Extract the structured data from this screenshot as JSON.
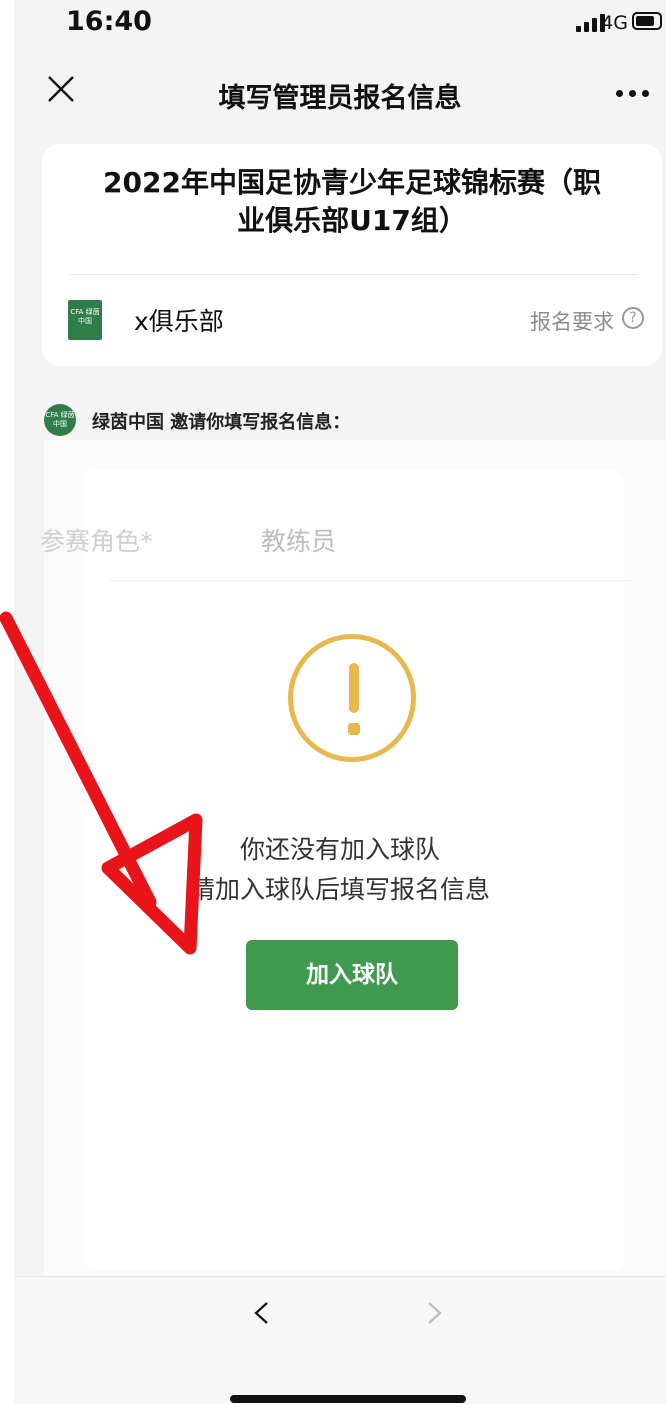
{
  "status_bar": {
    "time": "16:40",
    "network": "4G"
  },
  "navbar": {
    "title": "填写管理员报名信息"
  },
  "card": {
    "title_line1": "2022年中国足协青少年足球锦标赛（职",
    "title_line2": "业俱乐部U17组）",
    "club_name": "x俱乐部",
    "requirements_label": "报名要求",
    "club_logo_text": "CFA 绿茵中国"
  },
  "invite": {
    "text": "绿茵中国 邀请你填写报名信息：",
    "avatar_text": "CFA 绿茵中国"
  },
  "form": {
    "role_label": "参赛角色*",
    "role_value": "教练员"
  },
  "alert": {
    "line1": "你还没有加入球队",
    "line2": "请加入球队后填写报名信息",
    "button_label": "加入球队"
  },
  "colors": {
    "accent": "#3f9a4f",
    "warning": "#e8b84e",
    "annotation": "#e8141a"
  },
  "icons": {
    "close": "close-icon",
    "more": "more-icon",
    "help": "help-icon",
    "alert": "exclamation-icon",
    "back": "chevron-left-icon",
    "forward": "chevron-right-icon"
  }
}
